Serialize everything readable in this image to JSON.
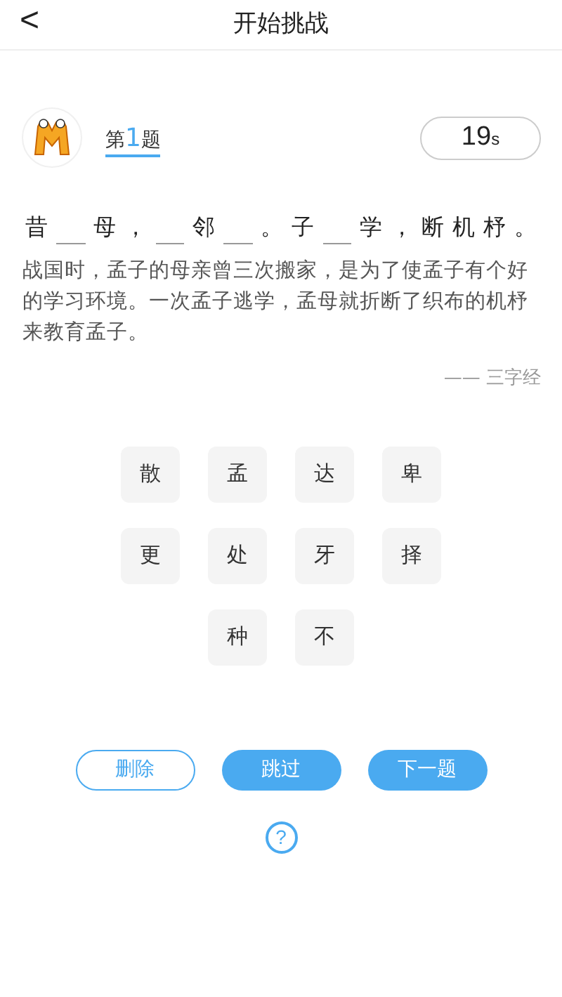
{
  "header": {
    "back": "<",
    "title": "开始挑战"
  },
  "question": {
    "prefix": "第",
    "number": "1",
    "suffix": "题"
  },
  "timer": {
    "value": "19",
    "unit": "s"
  },
  "puzzle": [
    {
      "kind": "char",
      "text": "昔"
    },
    {
      "kind": "blank"
    },
    {
      "kind": "char",
      "text": "母"
    },
    {
      "kind": "char",
      "text": "，"
    },
    {
      "kind": "blank"
    },
    {
      "kind": "char",
      "text": "邻"
    },
    {
      "kind": "blank"
    },
    {
      "kind": "char",
      "text": "。"
    },
    {
      "kind": "char",
      "text": "子"
    },
    {
      "kind": "blank"
    },
    {
      "kind": "char",
      "text": "学"
    },
    {
      "kind": "char",
      "text": "，"
    },
    {
      "kind": "char",
      "text": "断"
    },
    {
      "kind": "char",
      "text": "机"
    },
    {
      "kind": "char",
      "text": "杼"
    },
    {
      "kind": "char",
      "text": "。"
    }
  ],
  "explanation": "战国时，孟子的母亲曾三次搬家，是为了使孟子有个好的学习环境。一次孟子逃学，孟母就折断了织布的机杼来教育孟子。",
  "source": "—— 三字经",
  "choices": [
    [
      "散",
      "孟",
      "达",
      "卑"
    ],
    [
      "更",
      "处",
      "牙",
      "择"
    ],
    [
      "种",
      "不"
    ]
  ],
  "buttons": [
    {
      "label": "删除",
      "kind": "outline"
    },
    {
      "label": "跳过",
      "kind": "filled"
    },
    {
      "label": "下一题",
      "kind": "filled"
    }
  ],
  "help": "?"
}
